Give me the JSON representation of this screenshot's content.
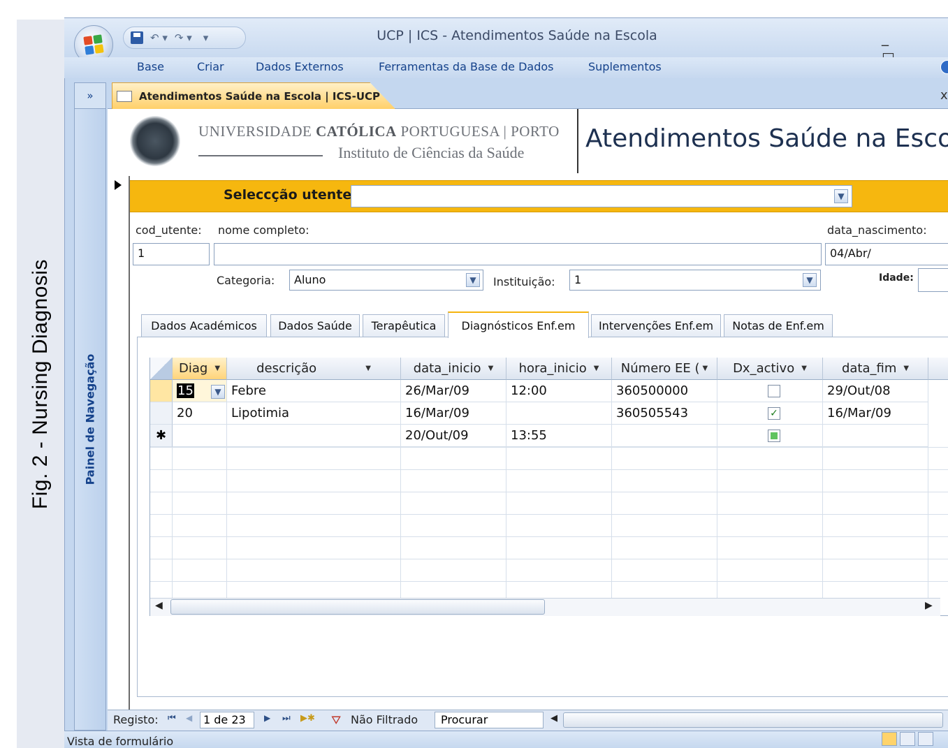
{
  "caption": "Fig. 2 -  Nursing Diagnosis",
  "window": {
    "title": "UCP | ICS - Atendimentos Saúde na Escola",
    "controls": "_ ▭ ✕",
    "qat_icons": [
      "save-icon",
      "undo-icon",
      "redo-icon",
      "customize-icon"
    ]
  },
  "menu": [
    "Base",
    "Criar",
    "Dados Externos",
    "Ferramentas da Base de Dados",
    "Suplementos"
  ],
  "nav": {
    "collapse": "»",
    "pane_label": "Painel de Navegação"
  },
  "doc_tab": {
    "label": "Atendimentos Saúde na Escola | ICS-UCP",
    "close": "x"
  },
  "header": {
    "uni_line1_a": "UNIVERSIDADE ",
    "uni_line1_b": "CATÓLICA",
    "uni_line1_c": " PORTUGUESA | PORTO",
    "uni_line2": "Instituto de Ciências da Saúde",
    "form_title": "Atendimentos Saúde na Escola"
  },
  "selection": {
    "label": "Seleccção utente",
    "value": ""
  },
  "fields": {
    "cod_utente_label": "cod_utente:",
    "nome_label": "nome completo:",
    "data_nasc_label": "data_nascimento:",
    "cod_utente_value": "1",
    "nome_value": "",
    "data_nasc_value": "04/Abr/",
    "categoria_label": "Categoria:",
    "categoria_value": "Aluno",
    "instituicao_label": "Instituição:",
    "instituicao_value": "1",
    "idade_label": "Idade:",
    "idade_value": ""
  },
  "tabs": [
    "Dados Académicos",
    "Dados Saúde",
    "Terapêutica",
    "Diagnósticos Enf.em",
    "Intervenções Enf.em",
    "Notas de Enf.em"
  ],
  "active_tab": "Diagnósticos Enf.em",
  "grid": {
    "columns": [
      "Diag",
      "descrição",
      "data_inicio",
      "hora_inicio",
      "Número EE (",
      "Dx_activo",
      "data_fim"
    ],
    "rows": [
      {
        "diag": "15",
        "descricao": "Febre",
        "data_inicio": "26/Mar/09",
        "hora_inicio": "12:00",
        "numero": "360500000",
        "activo": false,
        "data_fim": "29/Out/08"
      },
      {
        "diag": "20",
        "descricao": "Lipotimia",
        "data_inicio": "16/Mar/09",
        "hora_inicio": "",
        "numero": "360505543",
        "activo": true,
        "data_fim": "16/Mar/09"
      },
      {
        "diag": "",
        "descricao": "",
        "data_inicio": "20/Out/09",
        "hora_inicio": "13:55",
        "numero": "",
        "activo": null,
        "data_fim": ""
      }
    ],
    "new_row_marker": "✱"
  },
  "record_nav": {
    "label": "Registo:",
    "position": "1 de 23",
    "filter": "Não Filtrado",
    "search": "Procurar"
  },
  "status": {
    "text": "Vista de formulário"
  },
  "colors": {
    "accent": "#f6b70f",
    "chrome": "#c4d7ef",
    "link_blue": "#15428b"
  }
}
